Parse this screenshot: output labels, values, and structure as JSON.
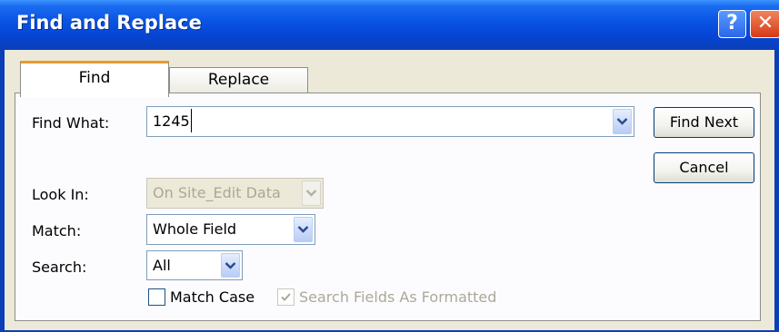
{
  "window": {
    "title": "Find and Replace",
    "help_glyph": "?",
    "close_glyph": "✕"
  },
  "tabs": [
    {
      "label": "Find",
      "selected": true
    },
    {
      "label": "Replace",
      "selected": false
    }
  ],
  "find_what": {
    "label": "Find What:",
    "value": "1245"
  },
  "look_in": {
    "label": "Look In:",
    "value": "On Site_Edit Data",
    "enabled": false
  },
  "match": {
    "label": "Match:",
    "value": "Whole Field"
  },
  "search": {
    "label": "Search:",
    "value": "All"
  },
  "options": {
    "match_case": {
      "label": "Match Case",
      "checked": false
    },
    "search_fields_as_formatted": {
      "label": "Search Fields As Formatted",
      "checked": true,
      "enabled": false
    }
  },
  "buttons": {
    "find_next": "Find Next",
    "cancel": "Cancel"
  },
  "icons": {
    "dropdown": "chevron-down-icon",
    "help": "help-icon",
    "close": "close-icon",
    "checkmark": "checkmark-icon"
  },
  "colors": {
    "titlebar": "#0A56E6",
    "tab_highlight": "#E69A2C",
    "dialog_bg": "#ECE9D8",
    "close_button": "#D53A14"
  }
}
